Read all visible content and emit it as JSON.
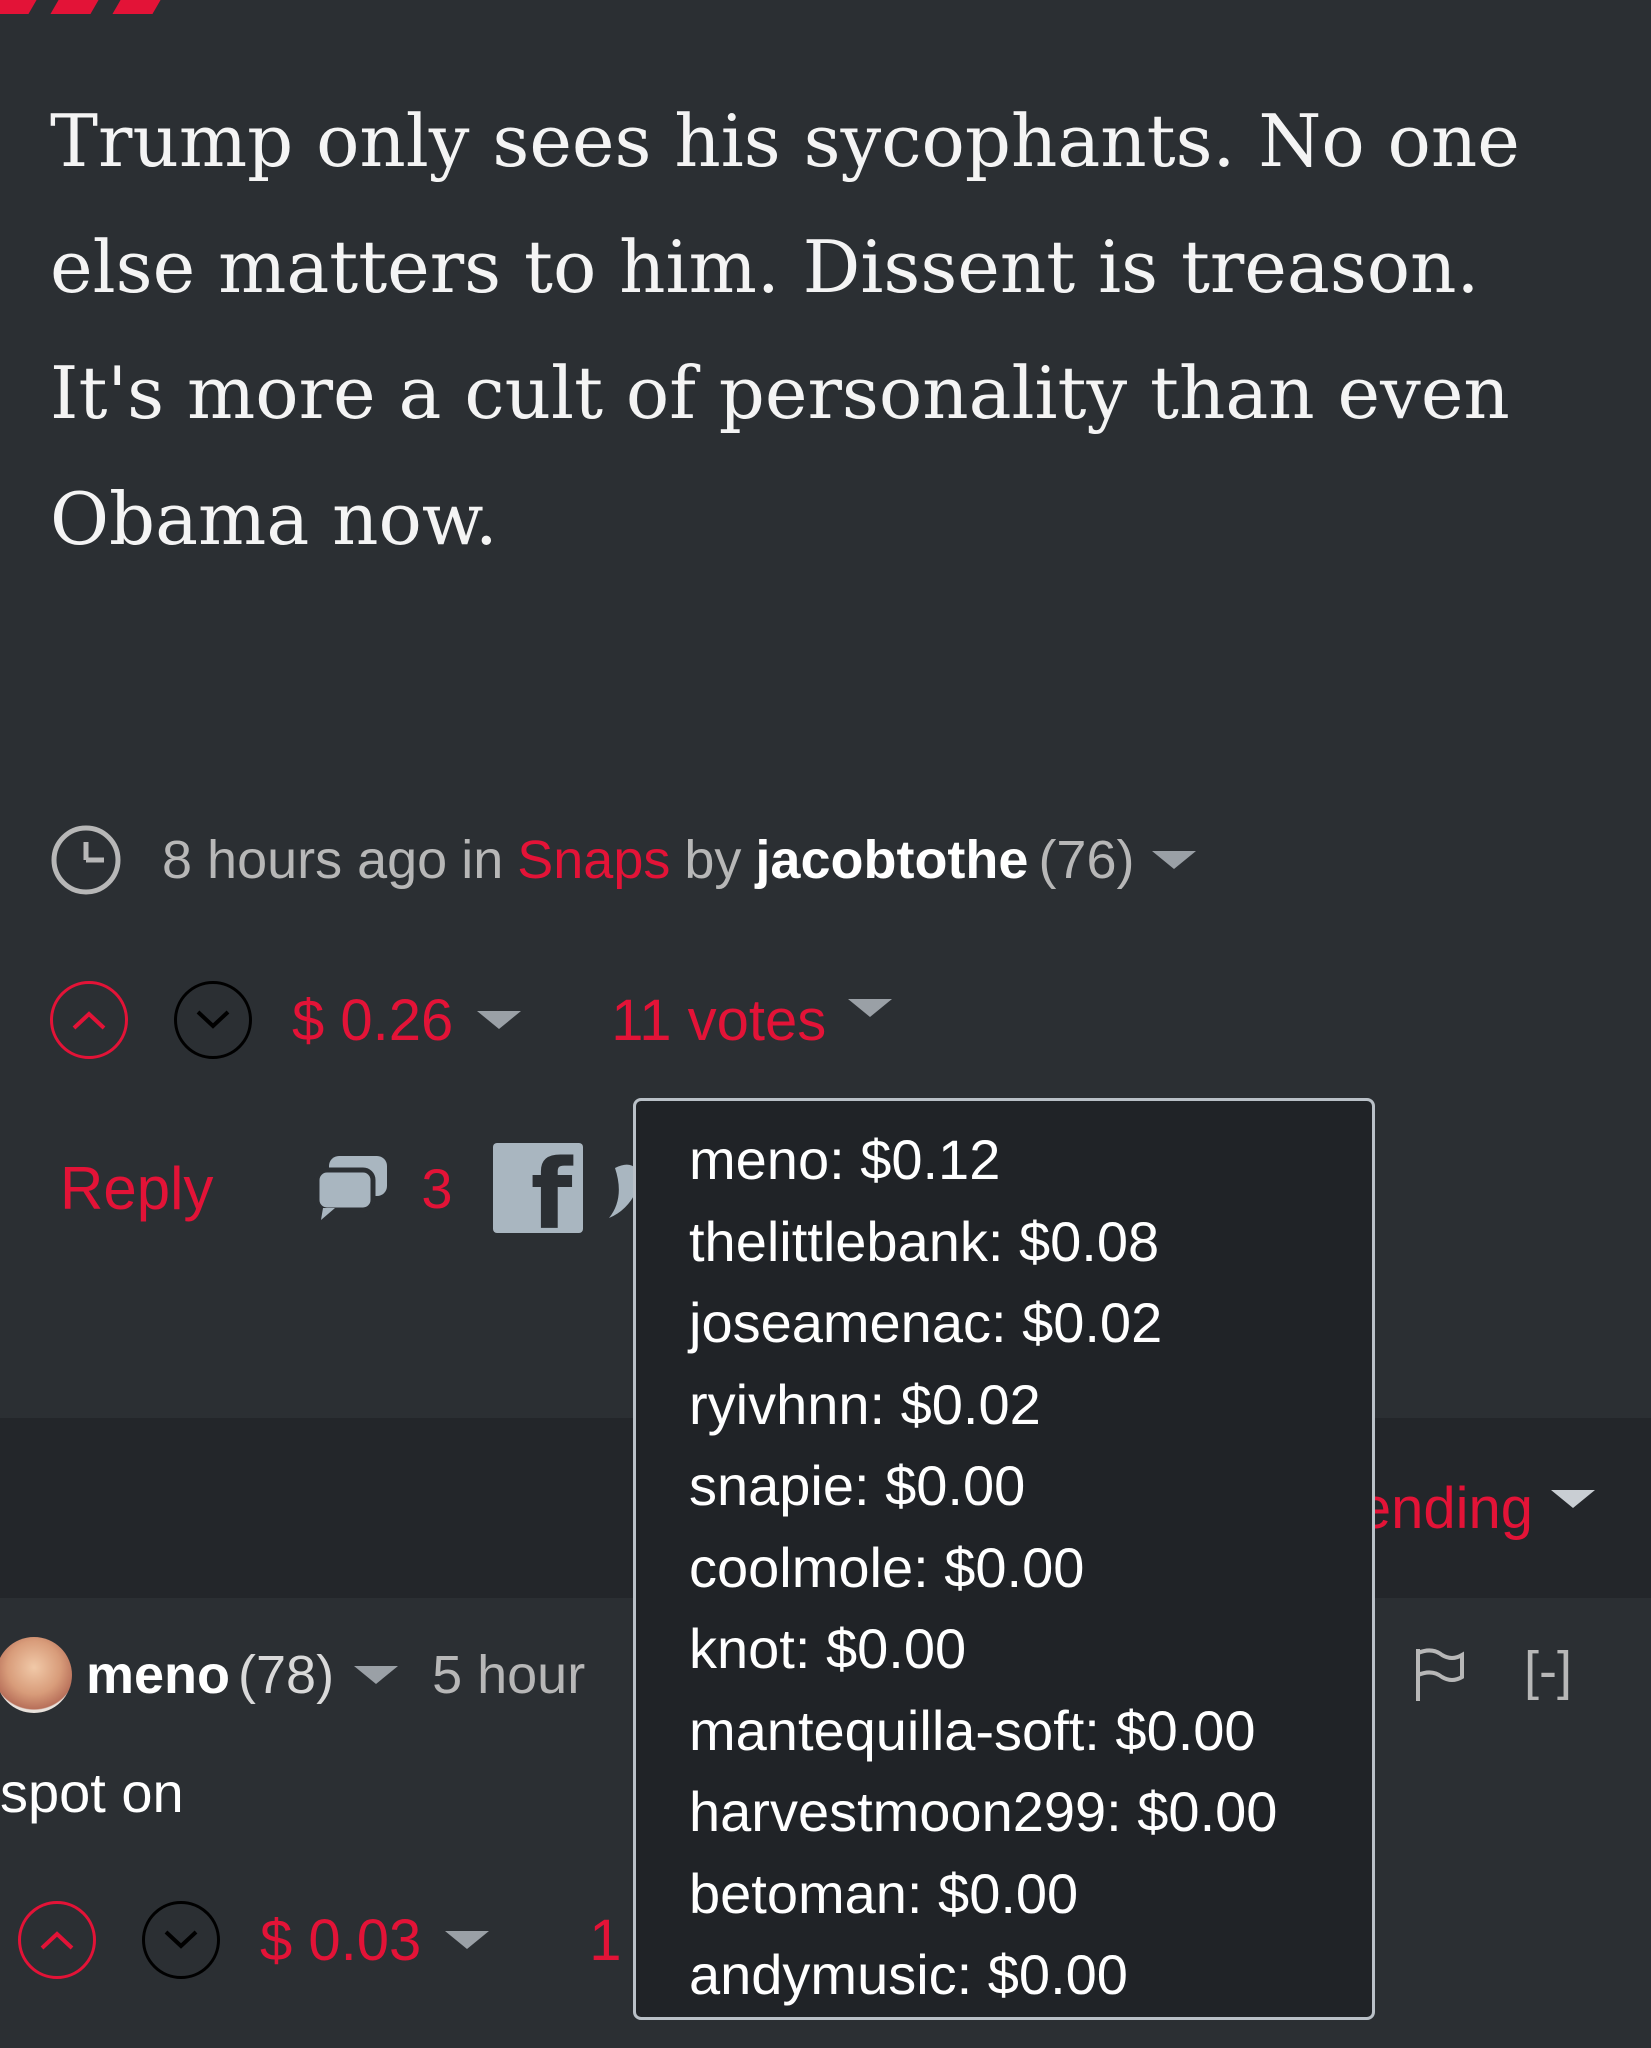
{
  "post": {
    "body": "Trump only sees his sycophants. No one else matters to him. Dissent is treason. It's more a cult of personality than even Obama now.",
    "time": "8 hours ago",
    "in_label": "in",
    "category": "Snaps",
    "by_label": "by",
    "author": "jacobtothe",
    "reputation": "(76)",
    "payout": "$ 0.26",
    "votes": "11 votes",
    "reply_label": "Reply",
    "comment_count": "3",
    "facebook_glyph": "f"
  },
  "sort": {
    "label": "Trending"
  },
  "comment": {
    "author": "meno",
    "reputation": "(78)",
    "time": "5 hour",
    "collapse": "[-]",
    "body": "spot on",
    "payout": "$ 0.03",
    "votes": "1"
  },
  "voters_tooltip": [
    "meno: $0.12",
    "thelittlebank: $0.08",
    "joseamenac: $0.02",
    "ryivhnn: $0.02",
    "snapie: $0.00",
    "coolmole: $0.00",
    "knot: $0.00",
    "mantequilla-soft: $0.00",
    "harvestmoon299: $0.00",
    "betoman: $0.00",
    "andymusic: $0.00"
  ],
  "colors": {
    "accent": "#e31337",
    "background": "#2b2f33",
    "sort_bar": "#23262a",
    "tooltip_bg": "#202327"
  },
  "icons": [
    "clock-icon",
    "chevron-down-icon",
    "upvote-icon",
    "downvote-icon",
    "comment-bubble-icon",
    "facebook-icon",
    "twitter-icon",
    "flag-icon",
    "avatar"
  ]
}
